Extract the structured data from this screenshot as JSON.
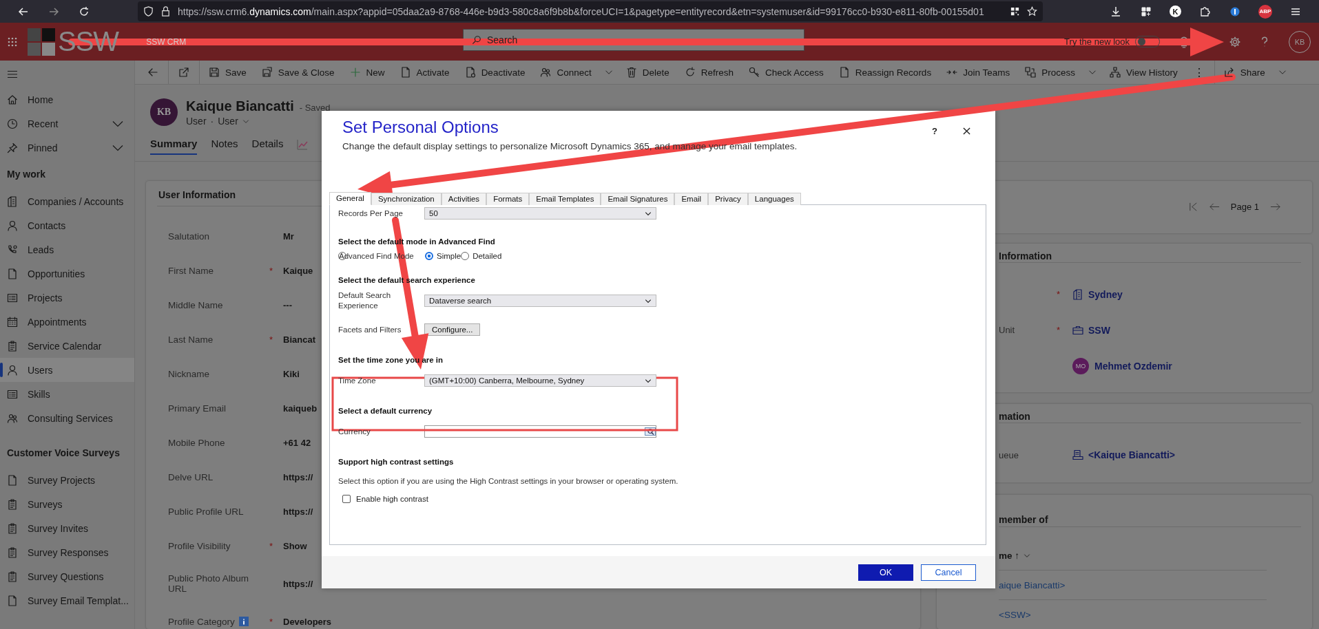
{
  "browser": {
    "url_start": "https://ssw.crm6.",
    "url_domain": "dynamics.com",
    "url_end": "/main.aspx?appid=05daa2a9-8768-446e-b9d3-580c8a6f9b8b&forceUCI=1&pagetype=entityrecord&etn=systemuser&id=99176cc0-b930-e811-80fb-00155d01",
    "profile_initial": "K",
    "adblock_badge": "ABP"
  },
  "app_header": {
    "logo": "SSW",
    "app_name": "SSW CRM",
    "search_placeholder": "Search",
    "new_look_label": "Try the new look",
    "new_look_on": false,
    "user_initials": "KB"
  },
  "command_bar": {
    "commands": [
      {
        "label": "Save",
        "menu": false
      },
      {
        "label": "Save & Close",
        "menu": false
      },
      {
        "label": "New",
        "menu": false
      },
      {
        "label": "Activate",
        "menu": false
      },
      {
        "label": "Deactivate",
        "menu": false
      },
      {
        "label": "Connect",
        "menu": true
      },
      {
        "label": "Delete",
        "menu": false
      },
      {
        "label": "Refresh",
        "menu": false
      },
      {
        "label": "Check Access",
        "menu": false
      },
      {
        "label": "Reassign Records",
        "menu": false
      },
      {
        "label": "Join Teams",
        "menu": false
      },
      {
        "label": "Process",
        "menu": true
      },
      {
        "label": "View History",
        "menu": false
      }
    ],
    "more": "⋮",
    "share": {
      "label": "Share",
      "menu": true
    }
  },
  "sidebar": {
    "pinned": [
      {
        "label": "Home",
        "has_menu": false
      },
      {
        "label": "Recent",
        "has_menu": true
      },
      {
        "label": "Pinned",
        "has_menu": true
      }
    ],
    "groups": [
      {
        "title": "My work",
        "items": [
          {
            "label": "Companies / Accounts",
            "selected": false
          },
          {
            "label": "Contacts",
            "selected": false
          },
          {
            "label": "Leads",
            "selected": false
          },
          {
            "label": "Opportunities",
            "selected": false
          },
          {
            "label": "Projects",
            "selected": false
          },
          {
            "label": "Appointments",
            "selected": false
          },
          {
            "label": "Service Calendar",
            "selected": false
          },
          {
            "label": "Users",
            "selected": true
          },
          {
            "label": "Skills",
            "selected": false
          },
          {
            "label": "Consulting Services",
            "selected": false
          }
        ]
      },
      {
        "title": "Customer Voice Surveys",
        "items": [
          {
            "label": "Survey Projects",
            "selected": false
          },
          {
            "label": "Surveys",
            "selected": false
          },
          {
            "label": "Survey Invites",
            "selected": false
          },
          {
            "label": "Survey Responses",
            "selected": false
          },
          {
            "label": "Survey Questions",
            "selected": false
          },
          {
            "label": "Survey Email Templat...",
            "selected": false
          }
        ]
      }
    ]
  },
  "record": {
    "initials": "KB",
    "name": "Kaique Biancatti",
    "status": "- Saved",
    "entity": "User",
    "separator": "·",
    "form": "User",
    "tabs": [
      {
        "label": "Summary",
        "selected": true
      },
      {
        "label": "Notes",
        "selected": false
      },
      {
        "label": "Details",
        "selected": false
      }
    ]
  },
  "user_information": {
    "title": "User Information",
    "required_marker": "*",
    "fields": [
      {
        "label": "Salutation",
        "required": false,
        "info": false,
        "value": "Mr"
      },
      {
        "label": "First Name",
        "required": true,
        "info": false,
        "value": "Kaique"
      },
      {
        "label": "Middle Name",
        "required": false,
        "info": false,
        "value": "---"
      },
      {
        "label": "Last Name",
        "required": true,
        "info": false,
        "value": "Biancat"
      },
      {
        "label": "Nickname",
        "required": false,
        "info": false,
        "value": "Kiki"
      },
      {
        "label": "Primary Email",
        "required": false,
        "info": false,
        "value": "kaiqueb"
      },
      {
        "label": "Mobile Phone",
        "required": false,
        "info": false,
        "value": "+61 42"
      },
      {
        "label": "Delve URL",
        "required": false,
        "info": false,
        "value": "https://"
      },
      {
        "label": "Public Profile URL",
        "required": false,
        "info": false,
        "value": "https://"
      },
      {
        "label": "Profile Visibility",
        "required": true,
        "info": false,
        "value": "Show"
      },
      {
        "label": "Public Photo Album URL",
        "required": false,
        "info": false,
        "value": "https://"
      },
      {
        "label": "Profile Category",
        "required": true,
        "info": true,
        "value": "Developers"
      }
    ]
  },
  "pager": {
    "page": "Page 1"
  },
  "organization_panel": {
    "title": "Information",
    "required_marker": "*",
    "fields": [
      {
        "required": true,
        "value": "Sydney"
      },
      {
        "label": "Unit",
        "required": true,
        "value": "SSW"
      },
      {
        "required": false,
        "avatar": "MO",
        "value": "Mehmet Ozdemir"
      }
    ]
  },
  "email_panel": {
    "title": "mation",
    "fields": [
      {
        "label": "ueue",
        "required": false,
        "value": "<Kaique Biancatti>"
      }
    ]
  },
  "teams_panel": {
    "title": "member of",
    "column": "me ↑",
    "rows": [
      "aique Biancatti>",
      "<SSW>"
    ]
  },
  "dialog": {
    "title": "Set Personal Options",
    "subtitle": "Change the default display settings to personalize Microsoft Dynamics 365, and manage your email templates.",
    "help": "?",
    "tabs": [
      {
        "label": "General",
        "selected": true
      },
      {
        "label": "Synchronization",
        "selected": false
      },
      {
        "label": "Activities",
        "selected": false
      },
      {
        "label": "Formats",
        "selected": false
      },
      {
        "label": "Email Templates",
        "selected": false
      },
      {
        "label": "Email Signatures",
        "selected": false
      },
      {
        "label": "Email",
        "selected": false
      },
      {
        "label": "Privacy",
        "selected": false
      },
      {
        "label": "Languages",
        "selected": false
      }
    ],
    "rows": [
      {
        "kind": "select",
        "label": "Records Per Page",
        "value": "50"
      },
      {
        "kind": "heading",
        "text": "Select the default mode in Advanced Find"
      },
      {
        "kind": "radio",
        "label": "Advanced Find Mode",
        "options": [
          {
            "label": "Simple",
            "selected": true
          },
          {
            "label": "Detailed",
            "selected": false
          }
        ]
      },
      {
        "kind": "heading",
        "text": "Select the default search experience"
      },
      {
        "kind": "select",
        "label": "Default Search Experience",
        "value": "Dataverse search"
      },
      {
        "kind": "button",
        "label": "Facets and Filters",
        "value": "Configure..."
      },
      {
        "kind": "heading",
        "text": "Set the time zone you are in"
      },
      {
        "kind": "select",
        "label": "Time Zone",
        "value": "(GMT+10:00) Canberra, Melbourne, Sydney"
      },
      {
        "kind": "heading",
        "text": "Select a default currency"
      },
      {
        "kind": "lookup",
        "label": "Currency"
      },
      {
        "kind": "heading",
        "text": "Support high contrast settings"
      },
      {
        "kind": "note",
        "text": "Select this option if you are using the High Contrast settings in your browser or operating system."
      },
      {
        "kind": "checkbox",
        "label": "Enable high contrast",
        "checked": false
      }
    ],
    "ok": "OK",
    "cancel": "Cancel"
  }
}
